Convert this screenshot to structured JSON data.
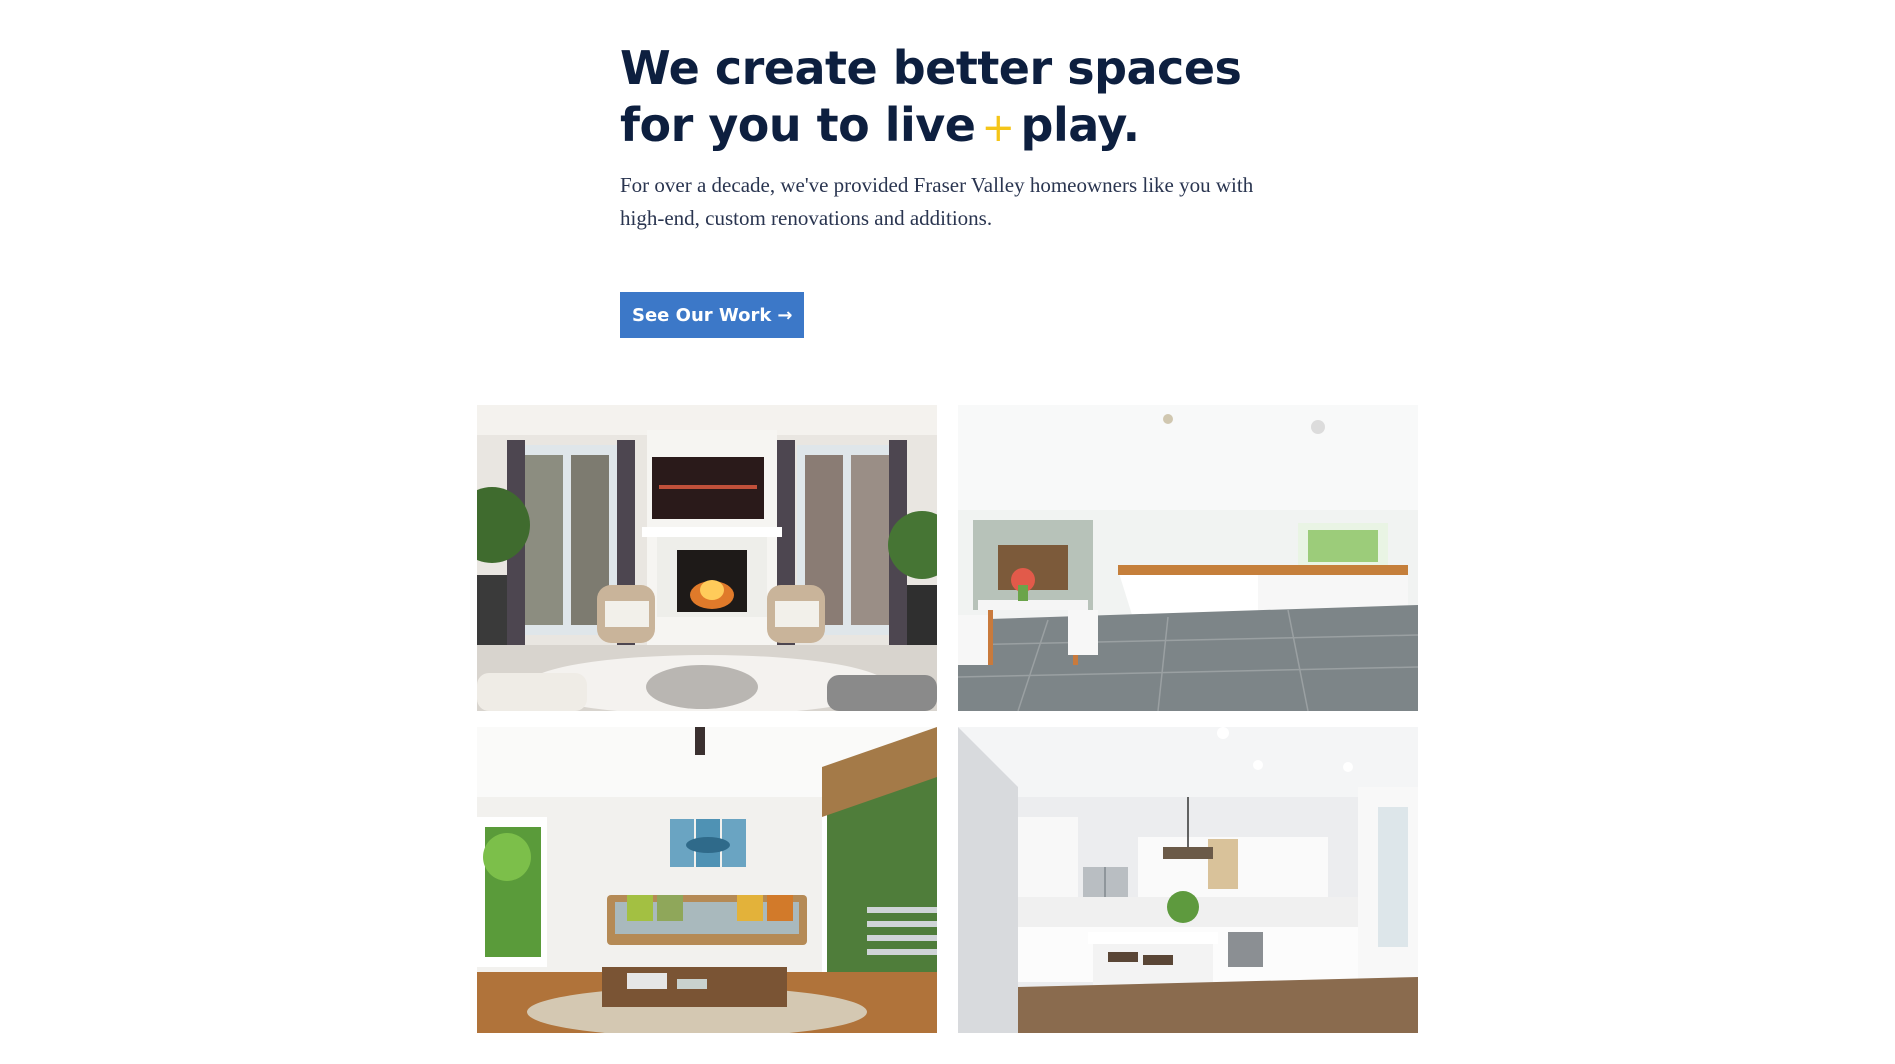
{
  "hero": {
    "headline_part1": "We create better spaces for you to live",
    "headline_plus": "+",
    "headline_part2": "play.",
    "subtext": "For over a decade, we've provided Fraser Valley homeowners like you with high-end, custom renovations and additions.",
    "cta_label": "See Our Work",
    "cta_icon": "arrow-right-icon"
  },
  "colors": {
    "headline": "#0d1f3f",
    "accent_plus": "#f5c518",
    "cta_background": "#3c78c8",
    "cta_text": "#ffffff"
  },
  "gallery": {
    "images": [
      {
        "subject": "living-room-fireplace"
      },
      {
        "subject": "open-kitchen-dining"
      },
      {
        "subject": "sunroom-sofa"
      },
      {
        "subject": "white-kitchen-island"
      }
    ]
  }
}
